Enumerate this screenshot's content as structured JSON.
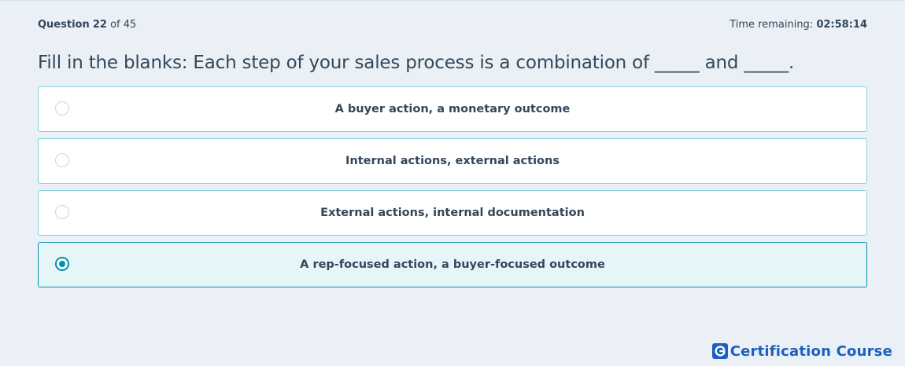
{
  "header": {
    "question_label": "Question",
    "question_number": "22",
    "question_of": "of 45",
    "time_label": "Time remaining:",
    "time_value": "02:58:14"
  },
  "question": {
    "text": "Fill in the blanks: Each step of your sales process is a combination of _____ and _____."
  },
  "options": [
    {
      "label": "A buyer action, a monetary outcome",
      "selected": false
    },
    {
      "label": "Internal actions, external actions",
      "selected": false
    },
    {
      "label": "External actions, internal documentation",
      "selected": false
    },
    {
      "label": "A rep-focused action, a buyer-focused outcome",
      "selected": true
    }
  ],
  "brand": {
    "name": "Certification Course",
    "logo_icon": "g-logo-icon"
  },
  "colors": {
    "background": "#eaf0f6",
    "text": "#33475b",
    "option_border": "#7fd1de",
    "selected_border": "#0091ae",
    "selected_background": "#e5f5f8",
    "brand": "#1c5fbe"
  }
}
